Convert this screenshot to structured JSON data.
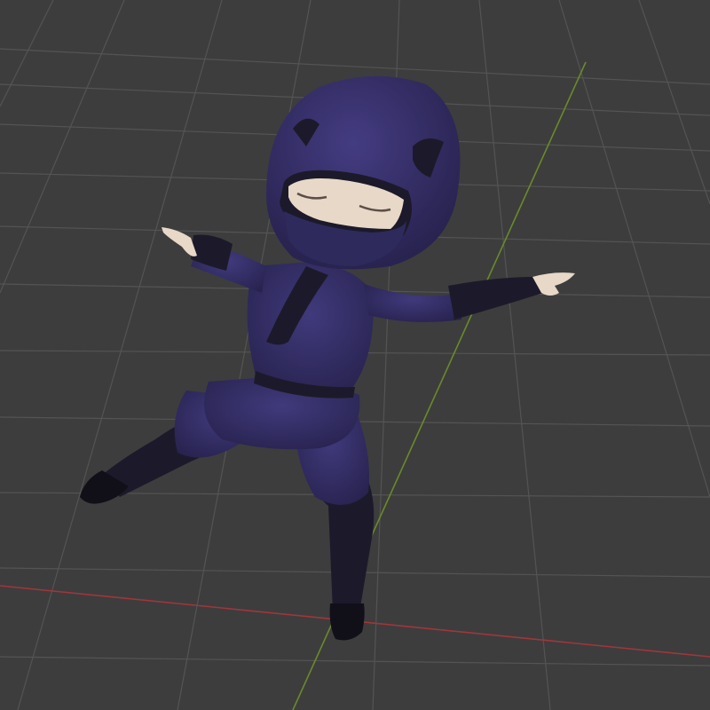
{
  "viewport": {
    "background": "#3d3d3d",
    "grid_color": "#555555",
    "x_axis_color": "#a0363c",
    "y_axis_color": "#6a8a2a"
  },
  "character": {
    "subject": "chibi ninja",
    "suit_color": "#3a3370",
    "suit_shadow": "#28244f",
    "dark_color": "#1c1a2a",
    "skin_color": "#e8d8c8"
  }
}
